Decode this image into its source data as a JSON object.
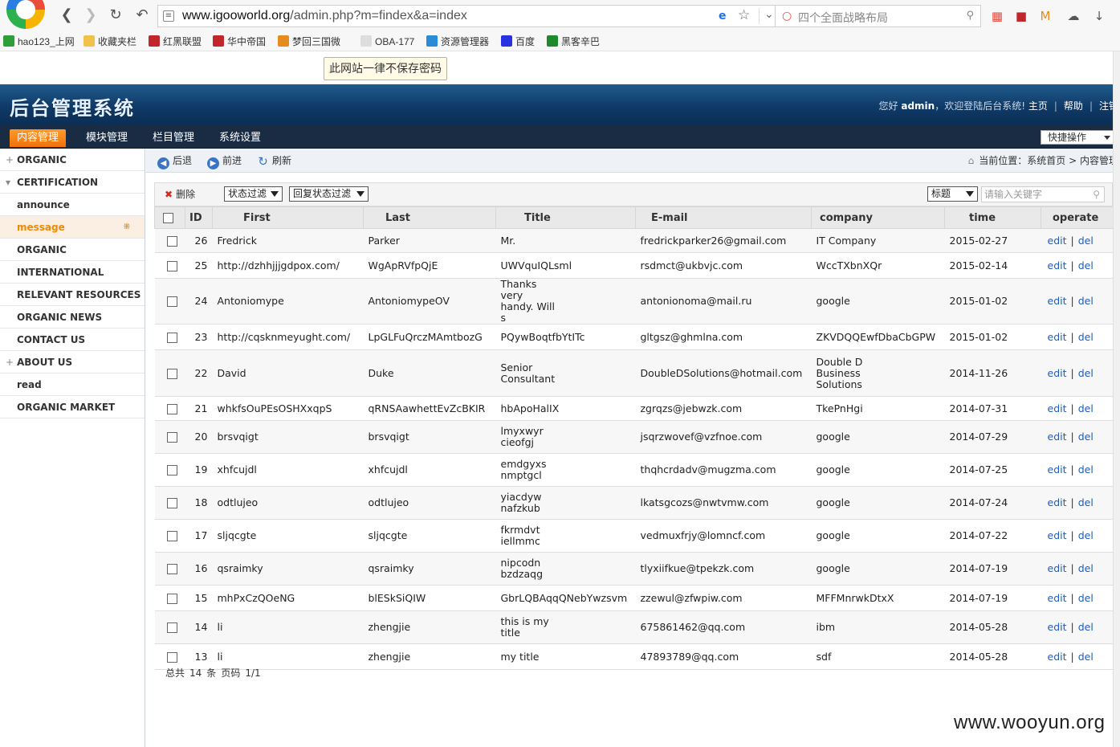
{
  "browser": {
    "url_host": "www.igooworld.org",
    "url_path": "/admin.php?m=findex&a=index",
    "search_placeholder": "四个全面战略布局",
    "bookmarks": [
      {
        "label": "hao123_上网",
        "color": "#2e9e3a"
      },
      {
        "label": "收藏夹栏",
        "color": "#f0c24b"
      },
      {
        "label": "红黑联盟",
        "color": "#c0262c"
      },
      {
        "label": "华中帝国",
        "color": "#c0262c"
      },
      {
        "label": "梦回三国微",
        "color": "#e58b1f"
      },
      {
        "label": "OBA-177",
        "color": "#dddddd"
      },
      {
        "label": "资源管理器",
        "color": "#2a8bd6"
      },
      {
        "label": "百度",
        "color": "#2932e1"
      },
      {
        "label": "黑客辛巴",
        "color": "#1f8a2b"
      }
    ],
    "password_tip": "此网站一律不保存密码"
  },
  "header": {
    "title": "后台管理系统",
    "greeting_prefix": "您好",
    "user": "admin",
    "greeting_suffix": "，欢迎登陆后台系统!",
    "home_link": "主页",
    "help_link": "帮助",
    "logout_link": "注销"
  },
  "nav": {
    "tabs": [
      "内容管理",
      "模块管理",
      "栏目管理",
      "系统设置"
    ],
    "active": 0,
    "quick_label": "快捷操作"
  },
  "sidebar": {
    "items": [
      {
        "label": "ORGANIC",
        "expander": "+"
      },
      {
        "label": "CERTIFICATION",
        "expander": "▾"
      },
      {
        "label": "announce",
        "expander": ""
      },
      {
        "label": "message",
        "expander": "",
        "active": true
      },
      {
        "label": "ORGANIC",
        "expander": ""
      },
      {
        "label": "INTERNATIONAL",
        "expander": ""
      },
      {
        "label": "RELEVANT RESOURCES",
        "expander": ""
      },
      {
        "label": "ORGANIC NEWS",
        "expander": ""
      },
      {
        "label": "CONTACT US",
        "expander": ""
      },
      {
        "label": "ABOUT US",
        "expander": "+"
      },
      {
        "label": "read",
        "expander": ""
      },
      {
        "label": "ORGANIC MARKET",
        "expander": ""
      }
    ]
  },
  "toolbar": {
    "back": "后退",
    "forward": "前进",
    "refresh": "刷新",
    "crumb_label": "当前位置：",
    "crumb_home": "系统首页",
    "crumb_sep": ">",
    "crumb_current": "内容管理"
  },
  "filter": {
    "delete_label": "删除",
    "status_filter": "状态过滤",
    "reply_filter": "回复状态过滤",
    "field_select": "标题",
    "keyword_placeholder": "请输入关键字"
  },
  "table": {
    "headers": [
      "ID",
      "First",
      "Last",
      "Title",
      "E-mail",
      "company",
      "time",
      "operate"
    ],
    "edit_label": "edit",
    "del_label": "del",
    "rows": [
      {
        "id": "26",
        "first": "Fredrick",
        "last": "Parker",
        "title": "Mr.",
        "email": "fredrickparker26@gmail.com",
        "company": "IT Company",
        "time": "2015-02-27"
      },
      {
        "id": "25",
        "first": "http://dzhhjjjgdpox.com/",
        "last": "WgApRVfpQjE",
        "title": "UWVquIQLsml",
        "email": "rsdmct@ukbvjc.com",
        "company": "WccTXbnXQr",
        "time": "2015-02-14"
      },
      {
        "id": "24",
        "first": "Antoniomype",
        "last": "AntoniomypeOV",
        "title": "Thanks very handy. Will s",
        "email": "antonionoma@mail.ru",
        "company": "google",
        "time": "2015-01-02"
      },
      {
        "id": "23",
        "first": "http://cqsknmeyught.com/",
        "last": "LpGLFuQrczMAmtbozG",
        "title": "PQywBoqtfbYtITc",
        "email": "gltgsz@ghmlna.com",
        "company": "ZKVDQQEwfDbaCbGPW",
        "time": "2015-01-02"
      },
      {
        "id": "22",
        "first": "David",
        "last": "Duke",
        "title": "Senior Consultant",
        "email": "DoubleDSolutions@hotmail.com",
        "company": "Double D Business Solutions",
        "time": "2014-11-26"
      },
      {
        "id": "21",
        "first": "whkfsOuPEsOSHXxqpS",
        "last": "qRNSAawhettEvZcBKIR",
        "title": "hbApoHalIX",
        "email": "zgrqzs@jebwzk.com",
        "company": "TkePnHgi",
        "time": "2014-07-31"
      },
      {
        "id": "20",
        "first": "brsvqigt",
        "last": "brsvqigt",
        "title": "lmyxwyr cieofgj",
        "email": "jsqrzwovef@vzfnoe.com",
        "company": "google",
        "time": "2014-07-29"
      },
      {
        "id": "19",
        "first": "xhfcujdl",
        "last": "xhfcujdl",
        "title": "emdgyxs nmptgcl",
        "email": "thqhcrdadv@mugzma.com",
        "company": "google",
        "time": "2014-07-25"
      },
      {
        "id": "18",
        "first": "odtlujeo",
        "last": "odtlujeo",
        "title": "yiacdyw nafzkub",
        "email": "lkatsgcozs@nwtvmw.com",
        "company": "google",
        "time": "2014-07-24"
      },
      {
        "id": "17",
        "first": "sljqcgte",
        "last": "sljqcgte",
        "title": "fkrmdvt iellmmc",
        "email": "vedmuxfrjy@lomncf.com",
        "company": "google",
        "time": "2014-07-22"
      },
      {
        "id": "16",
        "first": "qsraimky",
        "last": "qsraimky",
        "title": "nipcodn bzdzaqg",
        "email": "tlyxiifkue@tpekzk.com",
        "company": "google",
        "time": "2014-07-19"
      },
      {
        "id": "15",
        "first": "mhPxCzQOeNG",
        "last": "blESkSiQIW",
        "title": "GbrLQBAqqQNebYwzsvm",
        "email": "zzewul@zfwpiw.com",
        "company": "MFFMnrwkDtxX",
        "time": "2014-07-19"
      },
      {
        "id": "14",
        "first": "li",
        "last": "zhengjie",
        "title": "this is my title",
        "email": "675861462@qq.com",
        "company": "ibm",
        "time": "2014-05-28"
      },
      {
        "id": "13",
        "first": "li",
        "last": "zhengjie",
        "title": "my title",
        "email": "47893789@qq.com",
        "company": "sdf",
        "time": "2014-05-28"
      }
    ]
  },
  "pager": {
    "total_label": "总共",
    "total": "14",
    "unit": "条",
    "page_label": "页码",
    "page": "1/1"
  },
  "watermark": "www.wooyun.org"
}
